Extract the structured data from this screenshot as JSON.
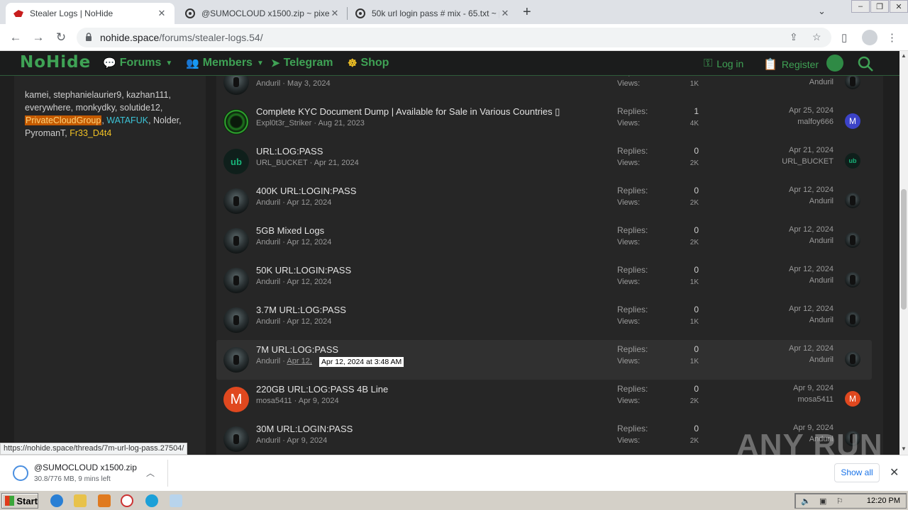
{
  "browser": {
    "tabs": [
      {
        "title": "Stealer Logs | NoHide",
        "active": true
      },
      {
        "title": "@SUMOCLOUD x1500.zip ~ pixeldrain",
        "active": false
      },
      {
        "title": "50k url login pass # mix - 65.txt ~ pixeldrain",
        "active": false
      }
    ],
    "url_host": "nohide.space",
    "url_path": "/forums/stealer-logs.54/",
    "status_url": "https://nohide.space/threads/7m-url-log-pass.27504/"
  },
  "site": {
    "logo": "NoHide",
    "nav": [
      {
        "label": "Forums",
        "icon": "chat-bubbles-icon"
      },
      {
        "label": "Members",
        "icon": "members-icon"
      },
      {
        "label": "Telegram",
        "icon": "telegram-icon"
      },
      {
        "label": "Shop",
        "icon": "shop-icon"
      }
    ],
    "login_label": "Log in",
    "register_label": "Register"
  },
  "sidebar": {
    "online_users": [
      {
        "name": "kamei",
        "style": "normal"
      },
      {
        "name": "stephanielaurier9",
        "style": "normal"
      },
      {
        "name": "kazhan111",
        "style": "normal"
      },
      {
        "name": "everywhere",
        "style": "normal"
      },
      {
        "name": "monkydky",
        "style": "normal"
      },
      {
        "name": "solutide12",
        "style": "normal"
      },
      {
        "name": "PrivateCloudGroup",
        "style": "highlight"
      },
      {
        "name": "WATAFUK",
        "style": "cyan"
      },
      {
        "name": "Nolder",
        "style": "normal"
      },
      {
        "name": "PyromanT",
        "style": "normal"
      },
      {
        "name": "Fr33_D4t4",
        "style": "yellow"
      }
    ]
  },
  "labels": {
    "replies": "Replies:",
    "views": "Views:"
  },
  "threads": [
    {
      "title": "",
      "author": "Anduril",
      "date": "May 3, 2024",
      "replies": "",
      "views": "1K",
      "last_date": "",
      "last_user": "Anduril",
      "avatar": "dark",
      "last_avatar": "dark",
      "partial": true
    },
    {
      "title": "Complete KYC Document Dump | Available for Sale in Various Countries ▯",
      "author": "Expl0t3r_Striker",
      "date": "Aug 21, 2023",
      "replies": "1",
      "views": "4K",
      "last_date": "Apr 25, 2024",
      "last_user": "malfoy666",
      "avatar": "kyc",
      "last_avatar": "m-blue"
    },
    {
      "title": "URL:LOG:PASS",
      "author": "URL_BUCKET",
      "date": "Apr 21, 2024",
      "replies": "0",
      "views": "2K",
      "last_date": "Apr 21, 2024",
      "last_user": "URL_BUCKET",
      "avatar": "ub",
      "last_avatar": "ub"
    },
    {
      "title": "400K URL:LOGIN:PASS",
      "author": "Anduril",
      "date": "Apr 12, 2024",
      "replies": "0",
      "views": "2K",
      "last_date": "Apr 12, 2024",
      "last_user": "Anduril",
      "avatar": "dark",
      "last_avatar": "dark"
    },
    {
      "title": "5GB Mixed Logs",
      "author": "Anduril",
      "date": "Apr 12, 2024",
      "replies": "0",
      "views": "2K",
      "last_date": "Apr 12, 2024",
      "last_user": "Anduril",
      "avatar": "dark",
      "last_avatar": "dark"
    },
    {
      "title": "50K URL:LOGIN:PASS",
      "author": "Anduril",
      "date": "Apr 12, 2024",
      "replies": "0",
      "views": "1K",
      "last_date": "Apr 12, 2024",
      "last_user": "Anduril",
      "avatar": "dark",
      "last_avatar": "dark"
    },
    {
      "title": "3.7M URL:LOG:PASS",
      "author": "Anduril",
      "date": "Apr 12, 2024",
      "replies": "0",
      "views": "1K",
      "last_date": "Apr 12, 2024",
      "last_user": "Anduril",
      "avatar": "dark",
      "last_avatar": "dark"
    },
    {
      "title": "7M URL:LOG:PASS",
      "author": "Anduril",
      "date": "Apr 12,",
      "replies": "0",
      "views": "1K",
      "last_date": "Apr 12, 2024",
      "last_user": "Anduril",
      "avatar": "dark",
      "last_avatar": "dark",
      "hover": true
    },
    {
      "title": "220GB URL:LOG:PASS 4B Line",
      "author": "mosa5411",
      "date": "Apr 9, 2024",
      "replies": "0",
      "views": "2K",
      "last_date": "Apr 9, 2024",
      "last_user": "mosa5411",
      "avatar": "m-red",
      "last_avatar": "m-red"
    },
    {
      "title": "30M URL:LOGIN:PASS",
      "author": "Anduril",
      "date": "Apr 9, 2024",
      "replies": "0",
      "views": "2K",
      "last_date": "Apr 9, 2024",
      "last_user": "Anduril",
      "avatar": "dark",
      "last_avatar": "dark"
    }
  ],
  "tooltip": "Apr 12, 2024 at 3:48 AM",
  "watermark": "ANY RUN",
  "download": {
    "name": "@SUMOCLOUD x1500.zip",
    "progress": "30.8/776 MB, 9 mins left",
    "show_all": "Show all"
  },
  "taskbar": {
    "start": "Start",
    "clock": "12:20 PM"
  },
  "colors": {
    "brand_green": "#3fa255",
    "header_bg": "#1b1c1c",
    "content_bg": "#262626"
  }
}
